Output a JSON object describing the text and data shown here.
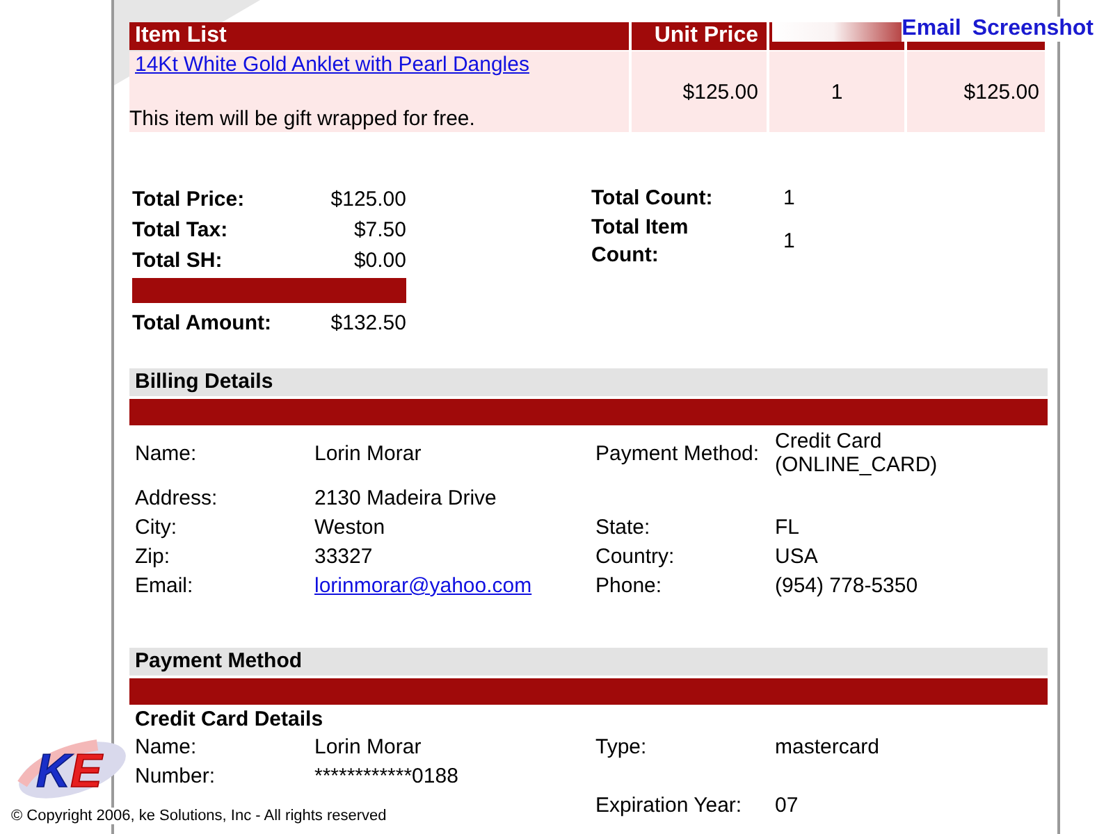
{
  "toolbar": {
    "links": [
      "Email",
      "Screenshot"
    ]
  },
  "item_table": {
    "columns": [
      "Item List",
      "Unit Price"
    ],
    "rows": [
      {
        "name": "14Kt White Gold Anklet with Pearl Dangles",
        "note": "This item will be gift wrapped for free.",
        "unit_price": "$125.00",
        "quantity": "1",
        "total": "$125.00"
      }
    ]
  },
  "totals": [
    {
      "label": "Total Price:",
      "value": "$125.00"
    },
    {
      "label": "Total Tax:",
      "value": "$7.50"
    },
    {
      "label": "Total SH:",
      "value": "$0.00"
    }
  ],
  "total_amount": {
    "label": "Total Amount:",
    "value": "$132.50"
  },
  "counts": [
    {
      "label": "Total Count:",
      "value": "1"
    },
    {
      "label": "Total Item Count:",
      "value": "1"
    }
  ],
  "billing": {
    "title": "Billing Details",
    "rows": [
      {
        "left": {
          "label": "Name:",
          "value": "Lorin Morar"
        },
        "right": {
          "label": "Payment Method:",
          "value": "Credit Card (ONLINE_CARD)"
        }
      },
      {
        "left": {
          "label": "Address:",
          "value": "2130 Madeira Drive"
        }
      },
      {
        "left": {
          "label": "City:",
          "value": "Weston"
        },
        "right": {
          "label": "State:",
          "value": "FL"
        }
      },
      {
        "left": {
          "label": "Zip:",
          "value": "33327"
        },
        "right": {
          "label": "Country:",
          "value": "USA"
        }
      },
      {
        "left": {
          "label": "Email:",
          "value": "lorinmorar@yahoo.com",
          "kind": "link"
        },
        "right": {
          "label": "Phone:",
          "value": "(954) 778-5350"
        }
      }
    ]
  },
  "payment": {
    "title": "Payment Method",
    "subtitle": "Credit Card Details",
    "rows": [
      {
        "left": {
          "label": "Name:",
          "value": "Lorin Morar"
        },
        "right": {
          "label": "Type:",
          "value": "mastercard"
        }
      },
      {
        "left": {
          "label": "Number:",
          "value": "************0188"
        }
      },
      {
        "right": {
          "label": "Expiration Year:",
          "value": "07"
        }
      }
    ]
  },
  "logo": {
    "text": "KE"
  },
  "copyright": "© Copyright 2006, ke Solutions, Inc - All rights reserved"
}
